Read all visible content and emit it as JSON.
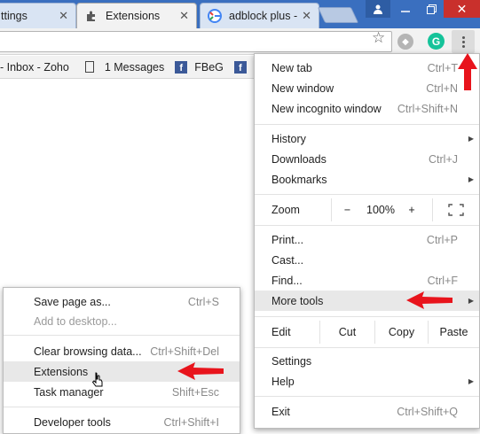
{
  "tabs": [
    {
      "label": "ttings"
    },
    {
      "label": "Extensions"
    },
    {
      "label": "adblock plus -"
    }
  ],
  "bookmarks": [
    {
      "label": "- Inbox - Zoho"
    },
    {
      "label": "1 Messages"
    },
    {
      "label": "FBeG"
    }
  ],
  "main_menu": {
    "new_tab": {
      "label": "New tab",
      "shortcut": "Ctrl+T"
    },
    "new_window": {
      "label": "New window",
      "shortcut": "Ctrl+N"
    },
    "new_incognito": {
      "label": "New incognito window",
      "shortcut": "Ctrl+Shift+N"
    },
    "history": {
      "label": "History"
    },
    "downloads": {
      "label": "Downloads",
      "shortcut": "Ctrl+J"
    },
    "bookmarks": {
      "label": "Bookmarks"
    },
    "zoom": {
      "label": "Zoom",
      "minus": "−",
      "level": "100%",
      "plus": "+"
    },
    "print": {
      "label": "Print...",
      "shortcut": "Ctrl+P"
    },
    "cast": {
      "label": "Cast..."
    },
    "find": {
      "label": "Find...",
      "shortcut": "Ctrl+F"
    },
    "more_tools": {
      "label": "More tools"
    },
    "edit": {
      "label": "Edit",
      "cut": "Cut",
      "copy": "Copy",
      "paste": "Paste"
    },
    "settings": {
      "label": "Settings"
    },
    "help": {
      "label": "Help"
    },
    "exit": {
      "label": "Exit",
      "shortcut": "Ctrl+Shift+Q"
    }
  },
  "sub_menu": {
    "save_page": {
      "label": "Save page as...",
      "shortcut": "Ctrl+S"
    },
    "add_desktop": {
      "label": "Add to desktop..."
    },
    "clear_browsing": {
      "label": "Clear browsing data...",
      "shortcut": "Ctrl+Shift+Del"
    },
    "extensions": {
      "label": "Extensions"
    },
    "task_manager": {
      "label": "Task manager",
      "shortcut": "Shift+Esc"
    },
    "developer_tools": {
      "label": "Developer tools",
      "shortcut": "Ctrl+Shift+I"
    }
  },
  "colors": {
    "title_bar": "#3a6fbf",
    "close_button": "#c9302c",
    "annotation_arrow": "#e8141c",
    "grammarly": "#15c39a",
    "facebook": "#3b5998"
  },
  "icons": [
    "puzzle-icon",
    "google-icon",
    "star-icon",
    "grammarly-icon",
    "menu-dots-icon",
    "facebook-icon",
    "document-icon",
    "submenu-arrow-icon",
    "fullscreen-icon",
    "mouse-cursor-icon",
    "red-arrow-icon"
  ]
}
